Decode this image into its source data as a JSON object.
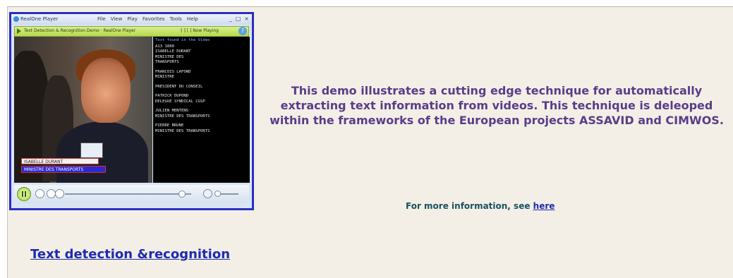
{
  "player": {
    "title": "RealOne Player",
    "menu": [
      "File",
      "View",
      "Play",
      "Favorites",
      "Tools",
      "Help"
    ],
    "window_buttons": [
      "_",
      "□",
      "×"
    ],
    "address": "Text Detection & Recognition Demo · RealOne Player",
    "toolbar_extra": "[ ] [ ] Now Playing",
    "help_icon": "question-icon",
    "caption_top": "ISABELLE DURANT",
    "caption_bottom": "MINISTRE DES TRANSPORTS",
    "text_panel_title": "Text found in the Video",
    "text_lines": [
      "A13 1000",
      "ISABELLE DURANT",
      "MINISTRE DES",
      "TRANSPORTS",
      "",
      "FRANCOIS LAFOND",
      "MINISTRE",
      "",
      "PRESIDENT DU CONSEIL",
      "",
      "PATRICK DUPOND",
      "DELEGUE SYNDICAL CGSP",
      "",
      "JULIEN MENTENS",
      "MINISTRE DES TRANSPORTS",
      "",
      "PIERRE BRUNE",
      "MINISTRE DES TRANSPORTS"
    ]
  },
  "left": {
    "demo_link": "Text detection &recognition"
  },
  "right": {
    "description": "This demo illustrates a cutting edge technique for automatically extracting text information from videos. This technique is deleoped within the frameworks of the European projects ASSAVID and CIMWOS.",
    "more_info_prefix": "For more information, see ",
    "more_info_link": "here"
  },
  "colors": {
    "player_border": "#2a2fc0",
    "link": "#1f2bb0",
    "description_text": "#5a3c8a",
    "more_info_text": "#1a5160",
    "panel_bg": "#f3efe6"
  }
}
